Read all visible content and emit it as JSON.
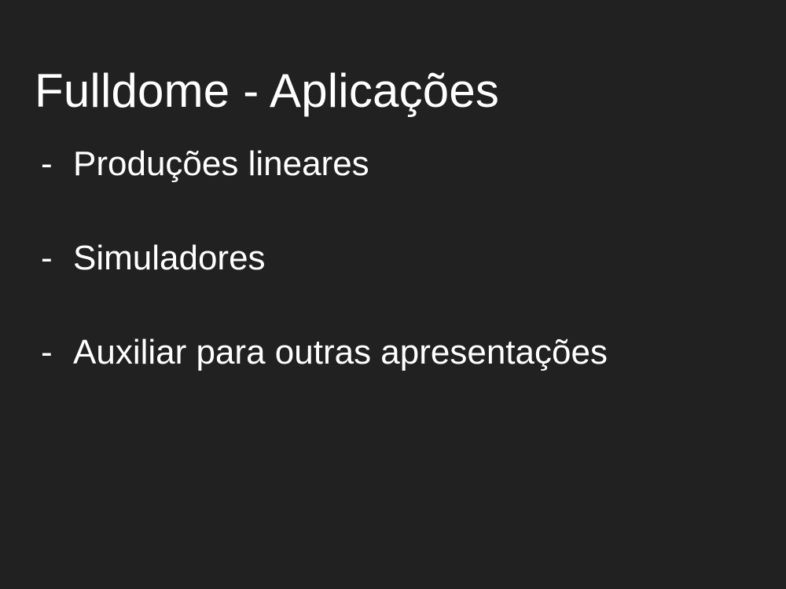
{
  "slide": {
    "title": "Fulldome - Aplicações",
    "bullet_marker": "-",
    "bullets": [
      "Produções lineares",
      "Simuladores",
      "Auxiliar para outras apresentações"
    ]
  },
  "colors": {
    "background": "#212121",
    "text": "#ffffff"
  }
}
